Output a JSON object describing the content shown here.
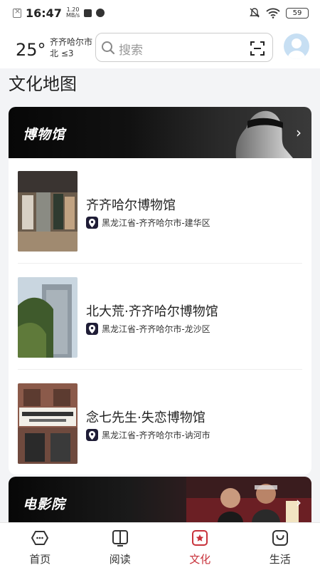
{
  "status_bar": {
    "time": "16:47",
    "net_speed_value": "1.20",
    "net_speed_unit": "MB/s",
    "battery": "59"
  },
  "header": {
    "temperature": "25°",
    "city": "齐齐哈尔市",
    "wind": "北 ≤3",
    "search_placeholder": "搜索"
  },
  "page_title": "文化地图",
  "museum_section": {
    "title": "博物馆",
    "items": [
      {
        "name": "齐齐哈尔博物馆",
        "location": "黑龙江省-齐齐哈尔市-建华区"
      },
      {
        "name": "北大荒·齐齐哈尔博物馆",
        "location": "黑龙江省-齐齐哈尔市-龙沙区"
      },
      {
        "name": "念七先生·失恋博物馆",
        "location": "黑龙江省-齐齐哈尔市-讷河市"
      }
    ]
  },
  "cinema_section": {
    "title": "电影院"
  },
  "tabs": [
    {
      "label": "首页",
      "icon": "home-icon"
    },
    {
      "label": "阅读",
      "icon": "book-icon"
    },
    {
      "label": "文化",
      "icon": "culture-star-icon",
      "active": true
    },
    {
      "label": "生活",
      "icon": "shopping-bag-icon"
    }
  ],
  "colors": {
    "accent": "#c8323b",
    "pin": "#1f1d36"
  }
}
